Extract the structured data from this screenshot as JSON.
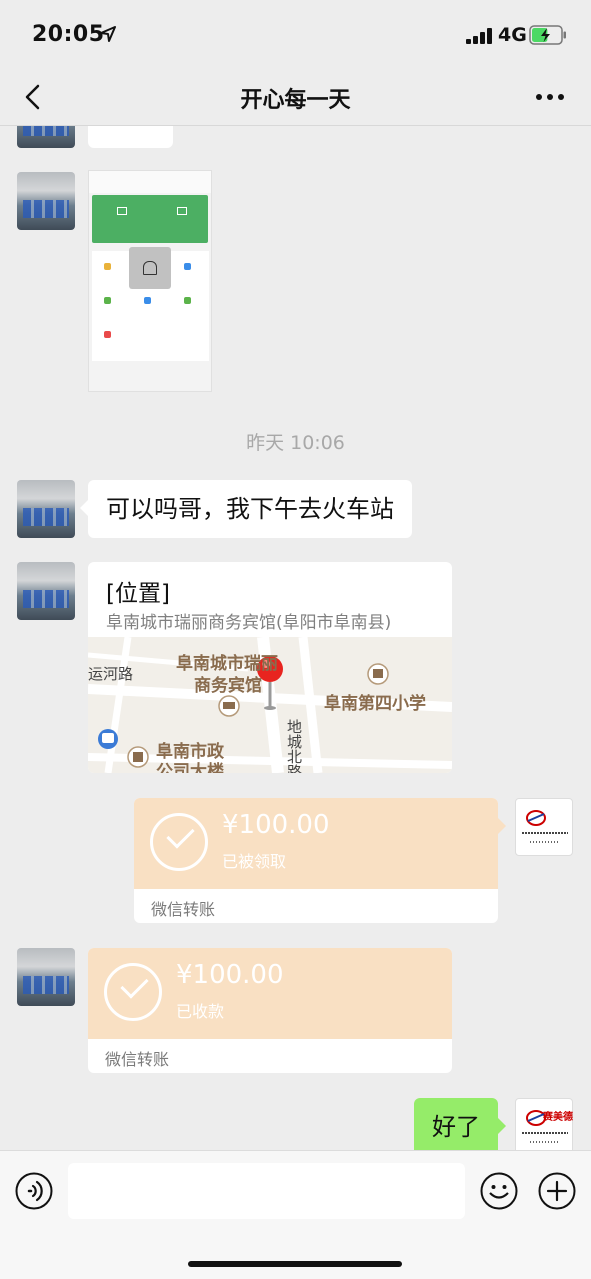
{
  "status_bar": {
    "time": "20:05",
    "network": "4G",
    "battery_level": 0.55,
    "battery_color": "#4cd964"
  },
  "nav": {
    "title": "开心每一天",
    "back_icon": "chevron-left-icon",
    "more_icon": "more-dots-icon"
  },
  "messages": {
    "timestamp": "昨天 10:06",
    "text_peer_1": "可以吗哥，我下午去火车站",
    "location": {
      "title": "[位置]",
      "address": "阜南城市瑞丽商务宾馆(阜阳市阜南县)",
      "map_labels": {
        "hotel_line1": "阜南城市瑞丽",
        "hotel_line2": "商务宾馆",
        "school": "阜南第四小学",
        "gov_line1": "阜南市政",
        "gov_line2": "公司大楼",
        "road_yunhe": "运河路",
        "road_dicheng": "地城北路"
      }
    },
    "transfer_sent": {
      "amount": "¥100.00",
      "status": "已被领取",
      "label": "微信转账"
    },
    "transfer_received": {
      "amount": "¥100.00",
      "status": "已收款",
      "label": "微信转账"
    },
    "text_mine_1": "好了",
    "my_avatar_logo": "赛美德"
  },
  "input_bar": {
    "value": "",
    "voice_icon": "voice-icon",
    "emoji_icon": "emoji-icon",
    "plus_icon": "plus-icon"
  },
  "colors": {
    "background": "#ededed",
    "my_bubble": "#95ec69",
    "transfer_card": "#f9e0c3",
    "payment_green": "#4caf63"
  }
}
